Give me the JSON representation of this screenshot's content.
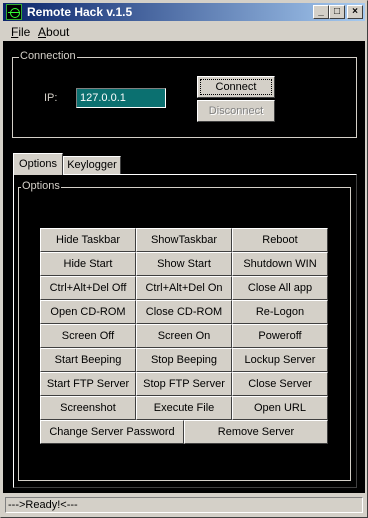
{
  "window": {
    "title": "Remote Hack v.1.5",
    "controls": {
      "minimize": "_",
      "maximize": "□",
      "close": "×"
    }
  },
  "menu": {
    "file": "File",
    "about": "About"
  },
  "connection": {
    "group_label": "Connection",
    "ip_label": "IP:",
    "ip_value": "127.0.0.1",
    "connect_label": "Connect",
    "disconnect_label": "Disconnect"
  },
  "tabs": [
    {
      "label": "Options",
      "active": true
    },
    {
      "label": "Keylogger",
      "active": false
    }
  ],
  "options": {
    "group_label": "Options",
    "buttons": [
      [
        "Hide Taskbar",
        "ShowTaskbar",
        "Reboot"
      ],
      [
        "Hide Start",
        "Show Start",
        "Shutdown WIN"
      ],
      [
        "Ctrl+Alt+Del Off",
        "Ctrl+Alt+Del On",
        "Close All app"
      ],
      [
        "Open CD-ROM",
        "Close CD-ROM",
        "Re-Logon"
      ],
      [
        "Screen Off",
        "Screen On",
        "Poweroff"
      ],
      [
        "Start Beeping",
        "Stop Beeping",
        "Lockup Server"
      ],
      [
        "Start FTP Server",
        "Stop FTP Server",
        "Close Server"
      ],
      [
        "Screenshot",
        "Execute File",
        "Open URL"
      ]
    ],
    "last_row": [
      "Change Server Password",
      "Remove Server"
    ]
  },
  "status": {
    "text": "--->Ready!<---"
  }
}
